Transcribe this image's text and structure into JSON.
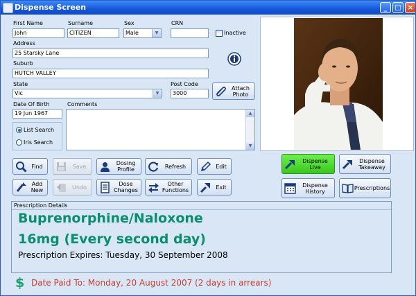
{
  "window": {
    "title": "Dispense Screen",
    "minimize": "_",
    "maximize": "□",
    "close": "×"
  },
  "patient": {
    "first_name_label": "First Name",
    "first_name": "John",
    "surname_label": "Surname",
    "surname": "CITIZEN",
    "sex_label": "Sex",
    "sex": "Male",
    "crn_label": "CRN",
    "crn": "",
    "inactive_label": "Inactive",
    "address_label": "Address",
    "address": "25 Starsky Lane",
    "suburb_label": "Suburb",
    "suburb": "HUTCH VALLEY",
    "state_label": "State",
    "state": "Vic",
    "postcode_label": "Post Code",
    "postcode": "3000",
    "dob_label": "Date Of Birth",
    "dob": "19 Jun 1967",
    "comments_label": "Comments",
    "comments": ""
  },
  "search": {
    "list_label": "List Search",
    "iris_label": "Iris Search",
    "selected": "list"
  },
  "attach_photo": {
    "label": "Attach\nPhoto"
  },
  "buttons": {
    "find": "Find",
    "save": "Save",
    "dosing_profile": "Dosing Profile",
    "refresh": "Refresh",
    "edit": "Edit",
    "add_new": "Add New",
    "undo": "Undo",
    "dose_changes": "Dose Changes",
    "other_functions": "Other Functions",
    "exit": "Exit",
    "dispense_live": "Dispense Live",
    "dispense_takeaway": "Dispense Takeaway",
    "dispense_history": "Dispense History",
    "prescriptions": "Prescriptions"
  },
  "prescription": {
    "header": "Prescription Details",
    "drug": "Buprenorphine/Naloxone",
    "dose": "16mg (Every second day)",
    "expires": "Prescription Expires: Tuesday, 30 September 2008"
  },
  "payment": {
    "icon": "$",
    "text": "Date Paid To: Monday, 20 August 2007 (2 days in arrears)"
  },
  "colors": {
    "accent_green": "#0A8E6E",
    "arrears_red": "#C83C2C",
    "dispense_live": "#4CD82C"
  }
}
